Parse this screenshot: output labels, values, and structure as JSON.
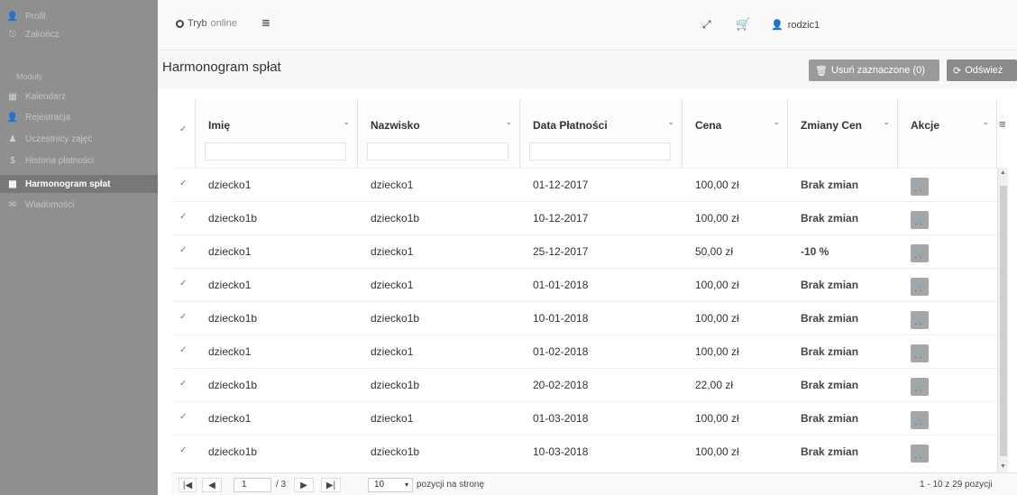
{
  "sidebar": {
    "items_top": [
      {
        "label": "Profil",
        "icon": "user-icon"
      },
      {
        "label": "Zakończ",
        "icon": "logout-icon"
      }
    ],
    "section": "Moduły",
    "items": [
      {
        "label": "Kalendarz",
        "icon": "calendar-icon"
      },
      {
        "label": "Rejestracja",
        "icon": "user-icon"
      },
      {
        "label": "Uczestnicy zajęć",
        "icon": "person-icon"
      },
      {
        "label": "Historia płatności",
        "icon": "dollar-icon"
      },
      {
        "label": "Harmonogram spłat",
        "icon": "calendar-icon",
        "active": true
      },
      {
        "label": "Wiadomości",
        "icon": "chat-icon"
      }
    ]
  },
  "topbar": {
    "status": "Tryb",
    "status_muted": "online",
    "menu_icon": "≣",
    "expand_icon": "⤢",
    "cart_icon": "🛒",
    "user": "rodzic1"
  },
  "header": {
    "title": "Harmonogram spłat",
    "delete_label": "Usuń zaznaczone (0)",
    "refresh_label": "Odśwież"
  },
  "table": {
    "columns": [
      "Imię",
      "Nazwisko",
      "Data Płatności",
      "Cena",
      "Zmiany Cen",
      "Akcje"
    ],
    "rows": [
      {
        "imie": "dziecko1",
        "nazwisko": "dziecko1",
        "data": "01-12-2017",
        "cena": "100,00 zł",
        "zmiany": "Brak zmian"
      },
      {
        "imie": "dziecko1b",
        "nazwisko": "dziecko1b",
        "data": "10-12-2017",
        "cena": "100,00 zł",
        "zmiany": "Brak zmian"
      },
      {
        "imie": "dziecko1",
        "nazwisko": "dziecko1",
        "data": "25-12-2017",
        "cena": "50,00 zł",
        "zmiany": "-10 %"
      },
      {
        "imie": "dziecko1",
        "nazwisko": "dziecko1",
        "data": "01-01-2018",
        "cena": "100,00 zł",
        "zmiany": "Brak zmian"
      },
      {
        "imie": "dziecko1b",
        "nazwisko": "dziecko1b",
        "data": "10-01-2018",
        "cena": "100,00 zł",
        "zmiany": "Brak zmian"
      },
      {
        "imie": "dziecko1",
        "nazwisko": "dziecko1",
        "data": "01-02-2018",
        "cena": "100,00 zł",
        "zmiany": "Brak zmian"
      },
      {
        "imie": "dziecko1b",
        "nazwisko": "dziecko1b",
        "data": "20-02-2018",
        "cena": "22,00 zł",
        "zmiany": "Brak zmian"
      },
      {
        "imie": "dziecko1",
        "nazwisko": "dziecko1",
        "data": "01-03-2018",
        "cena": "100,00 zł",
        "zmiany": "Brak zmian"
      },
      {
        "imie": "dziecko1b",
        "nazwisko": "dziecko1b",
        "data": "10-03-2018",
        "cena": "100,00 zł",
        "zmiany": "Brak zmian"
      }
    ]
  },
  "pager": {
    "first": "|◀",
    "prev": "◀",
    "page": "1",
    "of": "/ 3",
    "next": "▶",
    "last": "▶|",
    "page_size": "10",
    "per_page_label": "pozycji na stronę",
    "summary": "1 - 10 z 29 pozycji"
  }
}
